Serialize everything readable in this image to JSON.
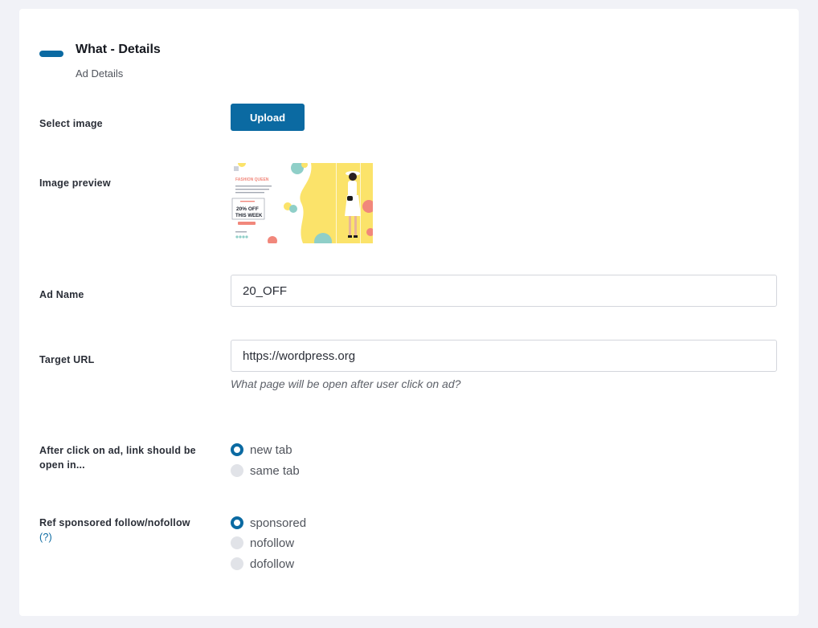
{
  "section": {
    "title": "What - Details",
    "subtitle": "Ad Details"
  },
  "fields": {
    "select_image": {
      "label": "Select image",
      "button_label": "Upload"
    },
    "image_preview": {
      "label": "Image preview",
      "banner": {
        "brand": "FASHION QUEEN",
        "offer_line1": "20% OFF",
        "offer_line2": "THIS WEEK"
      }
    },
    "ad_name": {
      "label": "Ad Name",
      "value": "20_OFF"
    },
    "target_url": {
      "label": "Target URL",
      "value": "https://wordpress.org",
      "hint": "What page will be open after user click on ad?"
    },
    "link_target": {
      "label": "After click on ad, link should be open in...",
      "options": [
        {
          "label": "new tab",
          "checked": true
        },
        {
          "label": "same tab",
          "checked": false
        }
      ]
    },
    "rel": {
      "label": "Ref sponsored follow/nofollow",
      "help": "(?)",
      "options": [
        {
          "label": "sponsored",
          "checked": true
        },
        {
          "label": "nofollow",
          "checked": false
        },
        {
          "label": "dofollow",
          "checked": false
        }
      ]
    }
  },
  "colors": {
    "accent": "#0b6aa2",
    "background": "#f1f2f7",
    "card": "#ffffff",
    "radio_unchecked": "#e1e3e8"
  }
}
